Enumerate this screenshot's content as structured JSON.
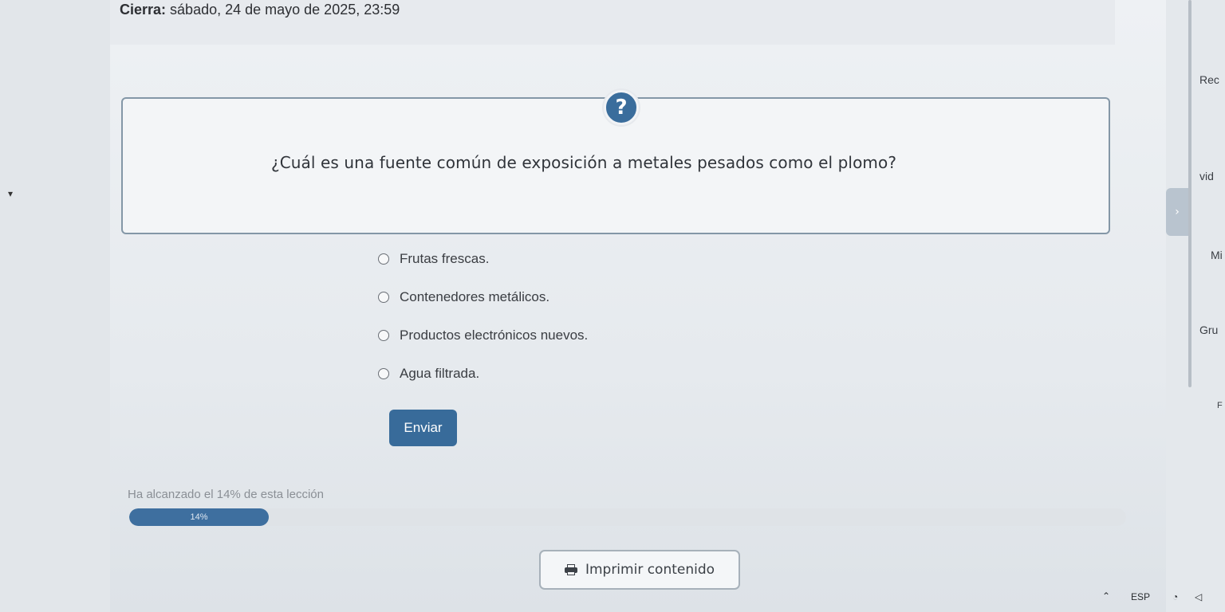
{
  "header": {
    "closes_label": "Cierra:",
    "closes_value": "sábado, 24 de mayo de 2025, 23:59"
  },
  "question": {
    "icon": "?",
    "text": "¿Cuál es una fuente común de exposición a metales pesados como el plomo?"
  },
  "options": [
    {
      "label": "Frutas frescas."
    },
    {
      "label": "Contenedores metálicos."
    },
    {
      "label": "Productos electrónicos nuevos."
    },
    {
      "label": "Agua filtrada."
    }
  ],
  "submit_label": "Enviar",
  "progress": {
    "text": "Ha alcanzado el 14% de esta lección",
    "value_label": "14%",
    "percent": 14
  },
  "print_label": "Imprimir contenido",
  "right_panel": {
    "items": [
      "Rec",
      "vid",
      "Mi",
      "Gru",
      "F"
    ]
  },
  "taskbar": {
    "language": "ESP"
  },
  "colors": {
    "accent": "#386b9a",
    "box_border": "#8497a7"
  }
}
